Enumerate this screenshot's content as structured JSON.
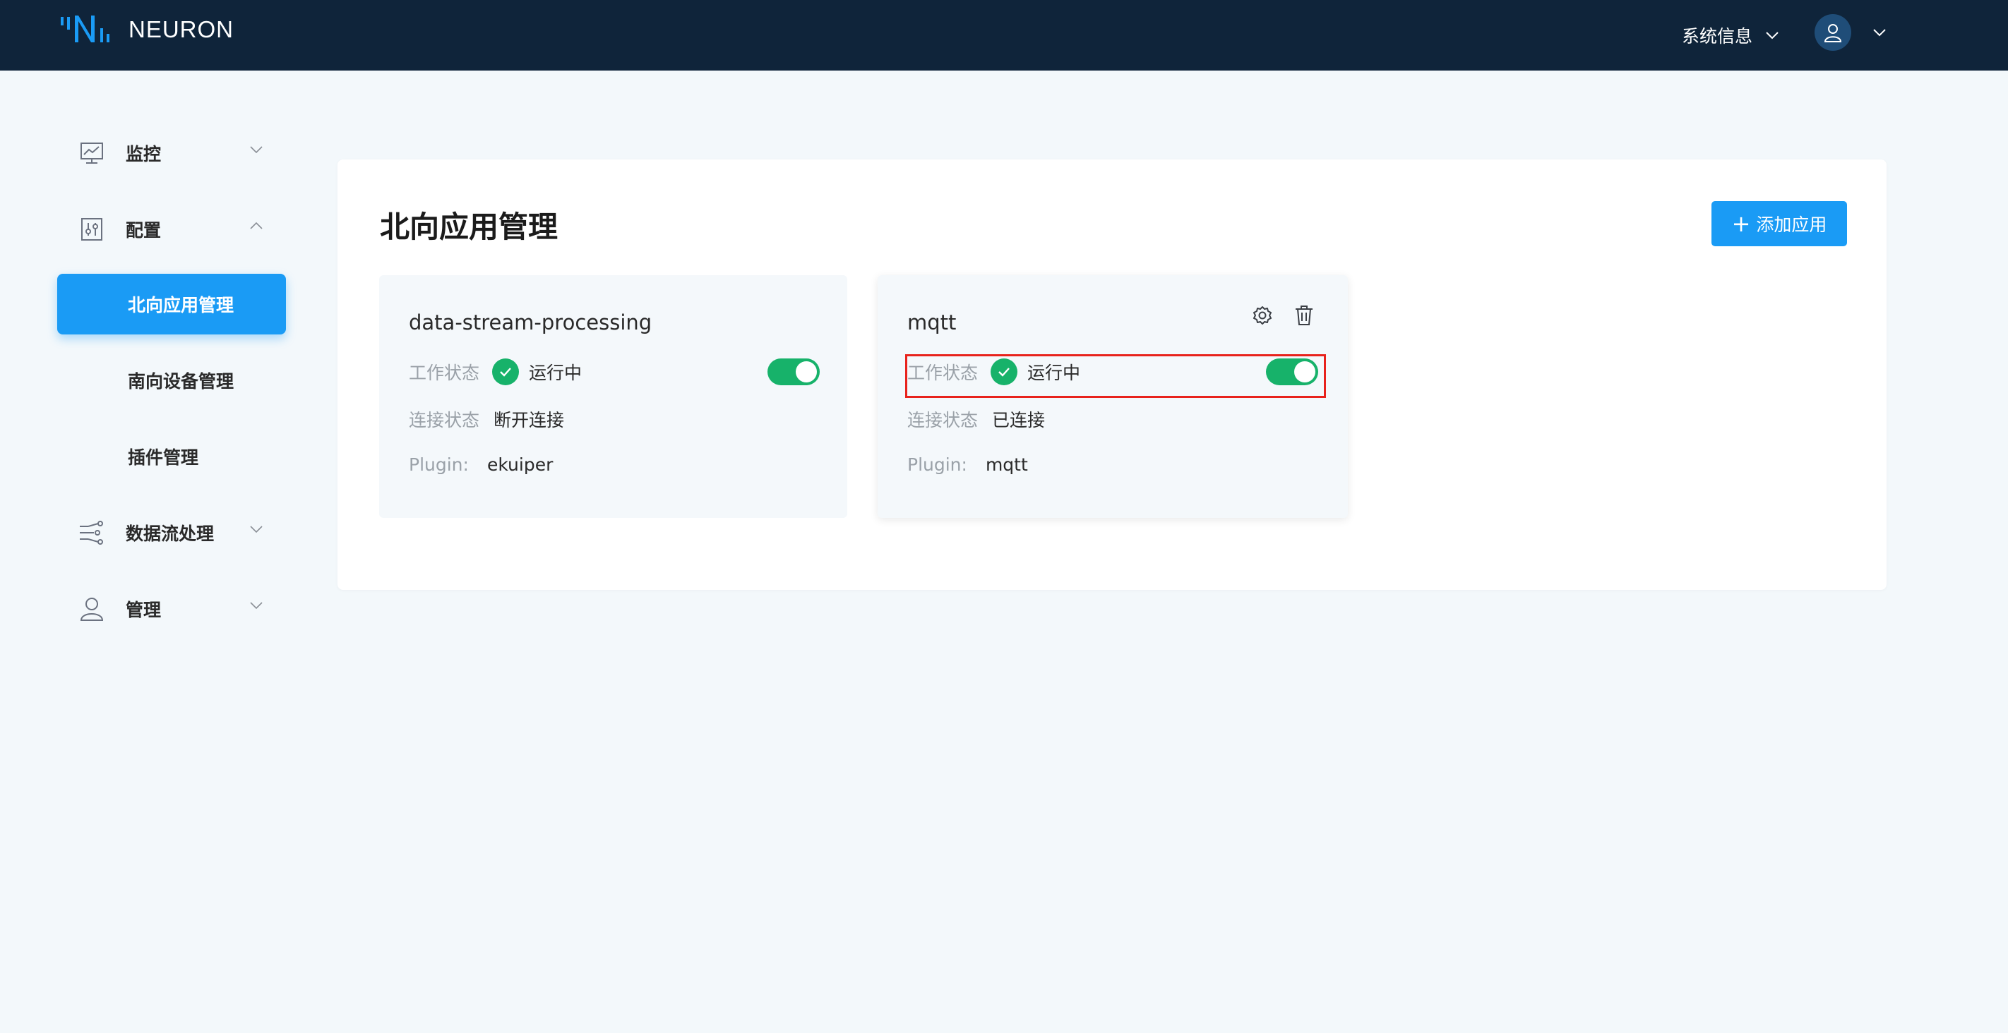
{
  "header": {
    "logo_text": "NEURON",
    "system_info_label": "系统信息",
    "bg_color": "#0f243a"
  },
  "sidebar": {
    "items": [
      {
        "label": "监控",
        "icon": "monitor-chart-icon",
        "expanded": false
      },
      {
        "label": "配置",
        "icon": "config-sliders-icon",
        "expanded": true,
        "children": [
          {
            "label": "北向应用管理",
            "active": true
          },
          {
            "label": "南向设备管理",
            "active": false
          },
          {
            "label": "插件管理",
            "active": false
          }
        ]
      },
      {
        "label": "数据流处理",
        "icon": "data-flow-icon",
        "expanded": false
      },
      {
        "label": "管理",
        "icon": "user-icon",
        "expanded": false
      }
    ]
  },
  "main": {
    "title": "北向应用管理",
    "add_button_label": "添加应用",
    "accent_color": "#1a9bf5",
    "cards": [
      {
        "name": "data-stream-processing",
        "work_status_label": "工作状态",
        "work_status": "运行中",
        "connection_label": "连接状态",
        "connection_status": "断开连接",
        "plugin_label": "Plugin:",
        "plugin": "ekuiper",
        "enabled": true
      },
      {
        "name": "mqtt",
        "work_status_label": "工作状态",
        "work_status": "运行中",
        "connection_label": "连接状态",
        "connection_status": "已连接",
        "plugin_label": "Plugin:",
        "plugin": "mqtt",
        "enabled": true
      }
    ],
    "status_color": "#17b26a",
    "highlight_color": "#e8221c"
  }
}
